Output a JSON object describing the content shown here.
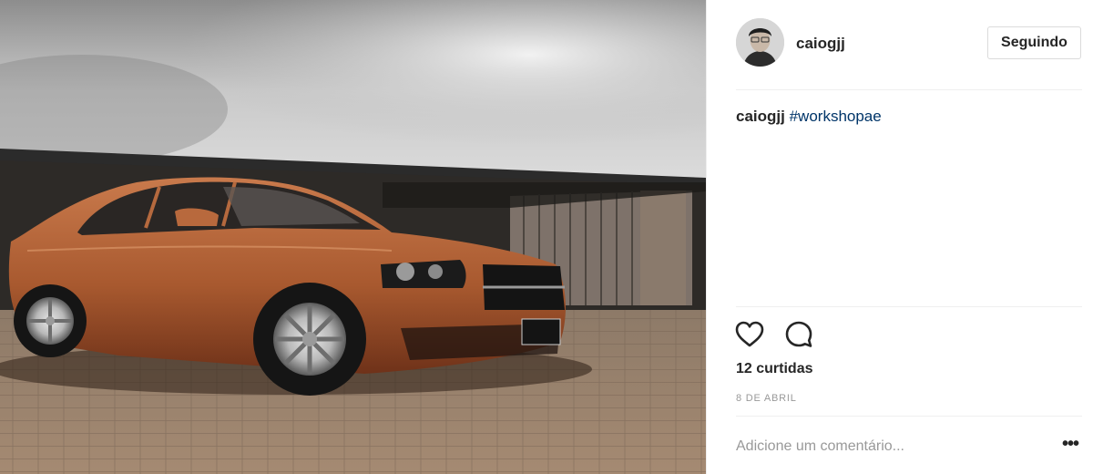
{
  "post": {
    "username": "caiogjj",
    "follow_label": "Seguindo",
    "caption": {
      "username": "caiogjj",
      "hashtag": "#workshopae"
    },
    "likes_text": "12 curtidas",
    "date_text": "8 DE ABRIL",
    "comment_placeholder": "Adicione um comentário...",
    "more_label": "•••"
  },
  "icons": {
    "like": "heart-outline-icon",
    "comment": "speech-bubble-icon",
    "more": "ellipsis-icon"
  },
  "colors": {
    "hashtag": "#003569",
    "muted": "#999999",
    "divider": "#efefef",
    "car_body": "#b2643a"
  }
}
